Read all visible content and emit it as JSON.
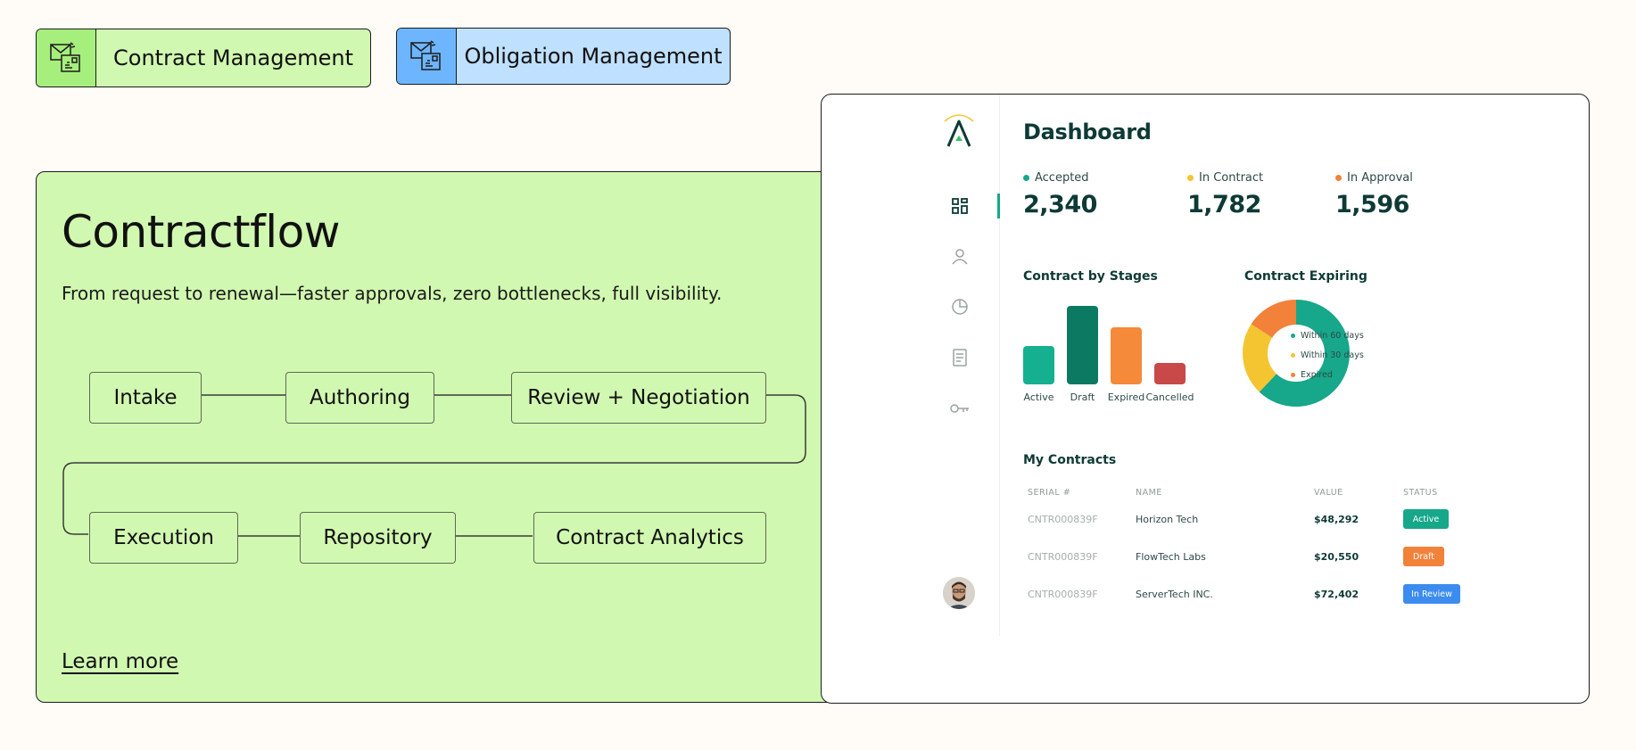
{
  "tabs": [
    {
      "label": "Contract Management",
      "icon": "envelope-document-icon"
    },
    {
      "label": "Obligation Management",
      "icon": "envelope-document-icon"
    }
  ],
  "card": {
    "title": "Contractflow",
    "subtitle": "From request to renewal—faster approvals, zero bottlenecks, full visibility.",
    "steps": [
      "Intake",
      "Authoring",
      "Review + Negotiation",
      "Execution",
      "Repository",
      "Contract Analytics"
    ],
    "learn_more": "Learn more"
  },
  "dashboard": {
    "title": "Dashboard",
    "stats": [
      {
        "label": "Accepted",
        "value": "2,340",
        "color": "#17a78a"
      },
      {
        "label": "In Contract",
        "value": "1,782",
        "color": "#f5c531"
      },
      {
        "label": "In Approval",
        "value": "1,596",
        "color": "#f2813a"
      }
    ],
    "stages_title": "Contract by Stages",
    "expiring_title": "Contract Expiring",
    "my_contracts_title": "My Contracts",
    "table_headers": [
      "SERIAL #",
      "NAME",
      "VALUE",
      "STATUS"
    ],
    "rows": [
      {
        "serial": "CNTR000839F",
        "name": "Horizon Tech",
        "value": "$48,292",
        "status": "Active",
        "status_color": "#17a78a"
      },
      {
        "serial": "CNTR000839F",
        "name": "FlowTech Labs",
        "value": "$20,550",
        "status": "Draft",
        "status_color": "#f2813a"
      },
      {
        "serial": "CNTR000839F",
        "name": "ServerTech INC.",
        "value": "$72,402",
        "status": "In Review",
        "status_color": "#3c8cf0"
      }
    ],
    "nav_icons": [
      "dashboard-grid-icon",
      "user-icon",
      "pie-chart-icon",
      "document-icon",
      "key-icon"
    ]
  },
  "chart_data": [
    {
      "type": "bar",
      "title": "Contract by Stages",
      "categories": [
        "Active",
        "Draft",
        "Expired",
        "Cancelled"
      ],
      "values": [
        36,
        73,
        53,
        20
      ],
      "colors": [
        "#14b08f",
        "#0c7a63",
        "#f48a3a",
        "#c94848"
      ]
    },
    {
      "type": "pie",
      "title": "Contract Expiring",
      "labels": [
        "Within 60 days",
        "Within 30 days",
        "Expired"
      ],
      "values": [
        62,
        22,
        16
      ],
      "colors": [
        "#17a78a",
        "#f5c531",
        "#f2813a"
      ]
    }
  ]
}
